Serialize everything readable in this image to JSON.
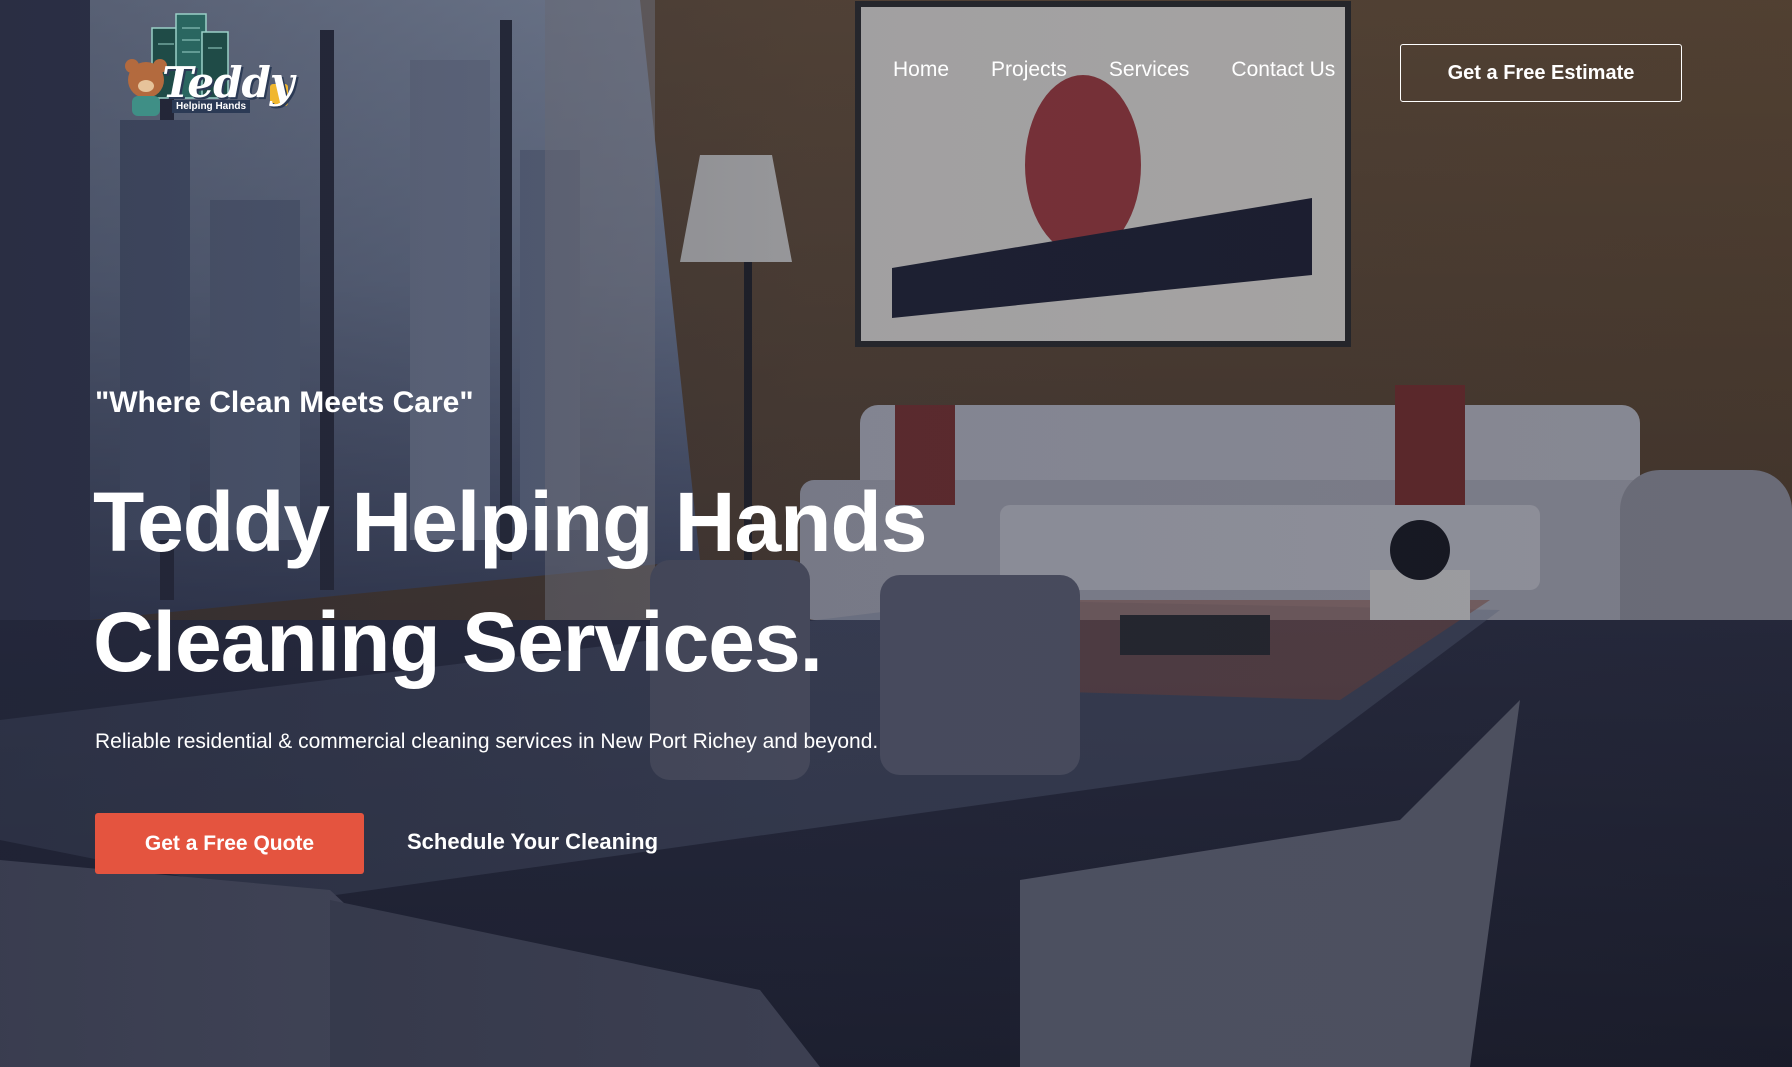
{
  "brand": {
    "logo_word": "Teddy",
    "logo_sub": "Helping Hands"
  },
  "nav": {
    "items": [
      "Home",
      "Projects",
      "Services",
      "Contact Us"
    ],
    "cta": "Get a Free Estimate"
  },
  "hero": {
    "tagline": "\"Where Clean Meets Care\"",
    "headline_line1": "Teddy Helping Hands",
    "headline_line2": "Cleaning Services.",
    "subtext": "Reliable residential & commercial cleaning services in New Port Richey and beyond.",
    "primary_button": "Get a Free Quote",
    "secondary_link": "Schedule Your Cleaning"
  },
  "colors": {
    "accent": "#e4543f",
    "text": "#ffffff",
    "overlay": "#1c2032"
  }
}
